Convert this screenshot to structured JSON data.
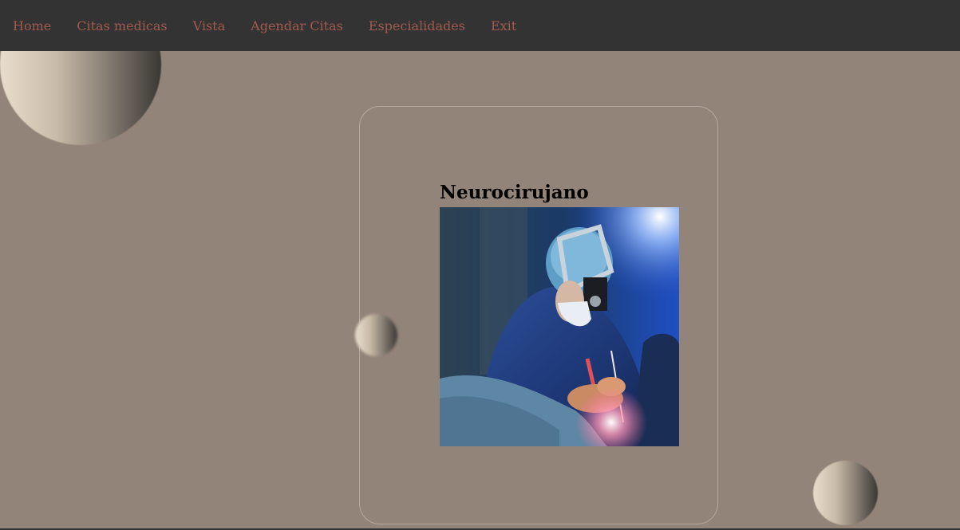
{
  "nav": {
    "items": [
      {
        "label": "Home"
      },
      {
        "label": "Citas medicas"
      },
      {
        "label": "Vista"
      },
      {
        "label": "Agendar Citas"
      },
      {
        "label": "Especialidades"
      },
      {
        "label": "Exit"
      }
    ],
    "link_color": "#a35a4e",
    "background": "#333333"
  },
  "page": {
    "background": "#938479"
  },
  "card": {
    "title": "Neurocirujano",
    "image": "neurosurgeon-photo"
  }
}
